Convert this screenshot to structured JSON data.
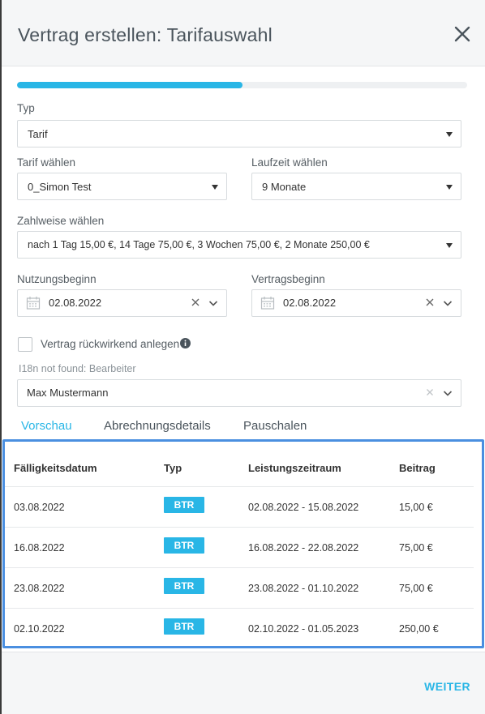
{
  "dialog": {
    "title": "Vertrag erstellen: Tarifauswahl",
    "progress_fraction": 0.5
  },
  "form": {
    "typ_label": "Typ",
    "typ_value": "Tarif",
    "tarif_label": "Tarif wählen",
    "tarif_value": "0_Simon Test",
    "laufzeit_label": "Laufzeit wählen",
    "laufzeit_value": "9 Monate",
    "zahlweise_label": "Zahlweise wählen",
    "zahlweise_value": "nach 1 Tag 15,00 €, 14 Tage 75,00 €, 3 Wochen 75,00 €, 2 Monate 250,00 €",
    "nutzungsbeginn_label": "Nutzungsbeginn",
    "nutzungsbeginn_value": "02.08.2022",
    "vertragsbeginn_label": "Vertragsbeginn",
    "vertragsbeginn_value": "02.08.2022",
    "rueckwirkend_label": "Vertrag rückwirkend anlegen",
    "bearbeiter_label": "I18n not found: Bearbeiter",
    "bearbeiter_value": "Max Mustermann"
  },
  "tabs": [
    {
      "label": "Vorschau",
      "active": true
    },
    {
      "label": "Abrechnungsdetails",
      "active": false
    },
    {
      "label": "Pauschalen",
      "active": false
    }
  ],
  "table": {
    "headers": [
      "Fälligkeitsdatum",
      "Typ",
      "Leistungszeitraum",
      "Beitrag"
    ],
    "rows": [
      {
        "date": "03.08.2022",
        "typ": "BTR",
        "period": "02.08.2022 - 15.08.2022",
        "amount": "15,00 €"
      },
      {
        "date": "16.08.2022",
        "typ": "BTR",
        "period": "16.08.2022 - 22.08.2022",
        "amount": "75,00 €"
      },
      {
        "date": "23.08.2022",
        "typ": "BTR",
        "period": "23.08.2022 - 01.10.2022",
        "amount": "75,00 €"
      },
      {
        "date": "02.10.2022",
        "typ": "BTR",
        "period": "02.10.2022 - 01.05.2023",
        "amount": "250,00 €"
      }
    ]
  },
  "footer": {
    "next_label": "WEITER"
  },
  "colors": {
    "accent": "#29b6e6",
    "highlight_border": "#4a8fe0"
  },
  "icons": [
    "close-icon",
    "calendar-icon",
    "clear-icon",
    "chevron-down-icon",
    "info-icon"
  ]
}
